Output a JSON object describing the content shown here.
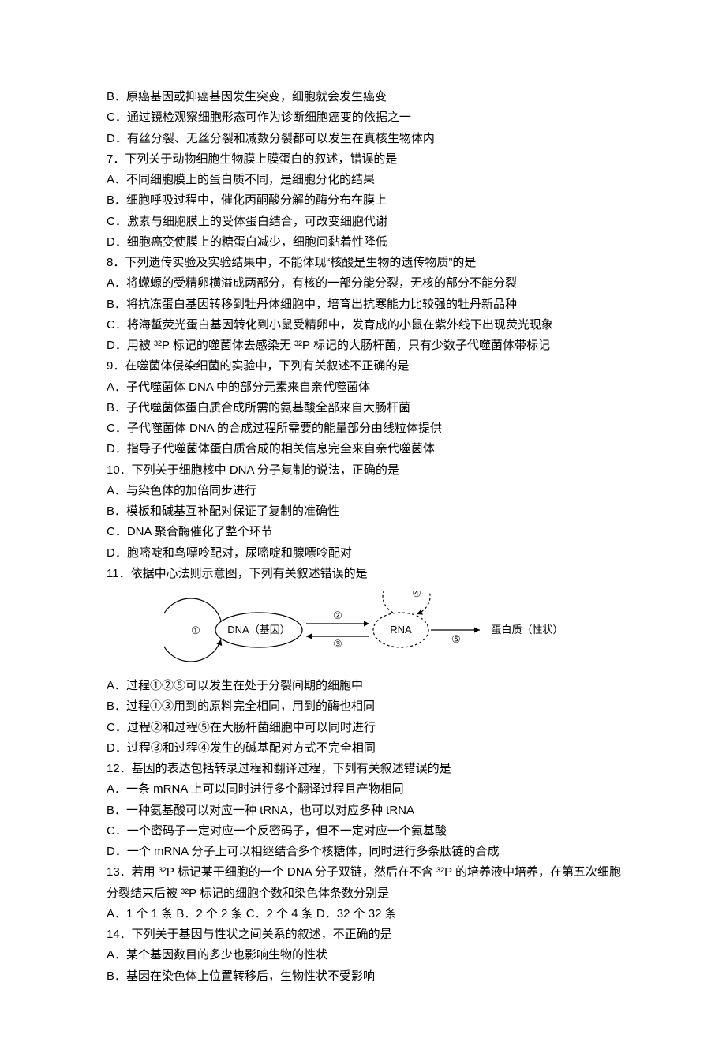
{
  "lines": {
    "q6_b": "B．原癌基因或抑癌基因发生突变，细胞就会发生癌变",
    "q6_c": "C．通过镜检观察细胞形态可作为诊断细胞癌变的依据之一",
    "q6_d": "D．有丝分裂、无丝分裂和减数分裂都可以发生在真核生物体内",
    "q7": "7．下列关于动物细胞生物膜上膜蛋白的叙述，错误的是",
    "q7_a": "A．不同细胞膜上的蛋白质不同，是细胞分化的结果",
    "q7_b": "B．细胞呼吸过程中，催化丙酮酸分解的酶分布在膜上",
    "q7_c": "C．激素与细胞膜上的受体蛋白结合，可改变细胞代谢",
    "q7_d": "D．细胞癌变使膜上的糖蛋白减少，细胞间黏着性降低",
    "q8": "8．下列遗传实验及实验结果中，不能体现“核酸是生物的遗传物质”的是",
    "q8_a": "A．将蝾螈的受精卵横溢成两部分，有核的一部分能分裂，无核的部分不能分裂",
    "q8_b": "B．将抗冻蛋白基因转移到牡丹体细胞中，培育出抗寒能力比较强的牡丹新品种",
    "q8_c": "C．将海蜇荧光蛋白基因转化到小鼠受精卵中，发育成的小鼠在紫外线下出现荧光现象",
    "q8_d": "D．用被 ³²P 标记的噬菌体去感染无 ³²P 标记的大肠杆菌，只有少数子代噬菌体带标记",
    "q9": "9．在噬菌体侵染细菌的实验中，下列有关叙述不正确的是",
    "q9_a": "A．子代噬菌体 DNA 中的部分元素来自亲代噬菌体",
    "q9_b": "B．子代噬菌体蛋白质合成所需的氨基酸全部来自大肠杆菌",
    "q9_c": "C．子代噬菌体 DNA 的合成过程所需要的能量部分由线粒体提供",
    "q9_d": "D．指导子代噬菌体蛋白质合成的相关信息完全来自亲代噬菌体",
    "q10": "10．下列关于细胞核中 DNA 分子复制的说法，正确的是",
    "q10_a": "A．与染色体的加倍同步进行",
    "q10_b": "B．模板和碱基互补配对保证了复制的准确性",
    "q10_c": "C．DNA 聚合酶催化了整个环节",
    "q10_d": "D．胞嘧啶和鸟嘌呤配对，尿嘧啶和腺嘌呤配对",
    "q11": "11．依据中心法则示意图，下列有关叙述错误的是",
    "q11_a": "A．过程①②⑤可以发生在处于分裂间期的细胞中",
    "q11_b": "B．过程①③用到的原料完全相同，用到的酶也相同",
    "q11_c": "C．过程②和过程⑤在大肠杆菌细胞中可以同时进行",
    "q11_d": "D．过程③和过程④发生的碱基配对方式不完全相同",
    "q12": "12．基因的表达包括转录过程和翻译过程，下列有关叙述错误的是",
    "q12_a": "A．一条 mRNA 上可以同时进行多个翻译过程且产物相同",
    "q12_b": "B．一种氨基酸可以对应一种 tRNA，也可以对应多种 tRNA",
    "q12_c": "C．一个密码子一定对应一个反密码子，但不一定对应一个氨基酸",
    "q12_d": "D．一个 mRNA 分子上可以相继结合多个核糖体，同时进行多条肽链的合成",
    "q13": "13．若用 ³²P 标记某干细胞的一个 DNA 分子双链，然后在不含 ³²P 的培养液中培养，在第五次细胞分裂结束后被 ³²P 标记的细胞个数和染色体条数分别是",
    "q13_opts": "A．1 个 1 条  B．2 个 2 条  C．2 个 4 条  D．32 个 32 条",
    "q14": "14．下列关于基因与性状之间关系的叙述，不正确的是",
    "q14_a": "A．某个基因数目的多少也影响生物的性状",
    "q14_b": "B．基因在染色体上位置转移后，生物性状不受影响"
  },
  "diagram": {
    "dna_label": "DNA（基因）",
    "rna_label": "RNA",
    "protein_label": "蛋白质（性状）",
    "n1": "①",
    "n2": "②",
    "n3": "③",
    "n4": "④",
    "n5": "⑤"
  }
}
